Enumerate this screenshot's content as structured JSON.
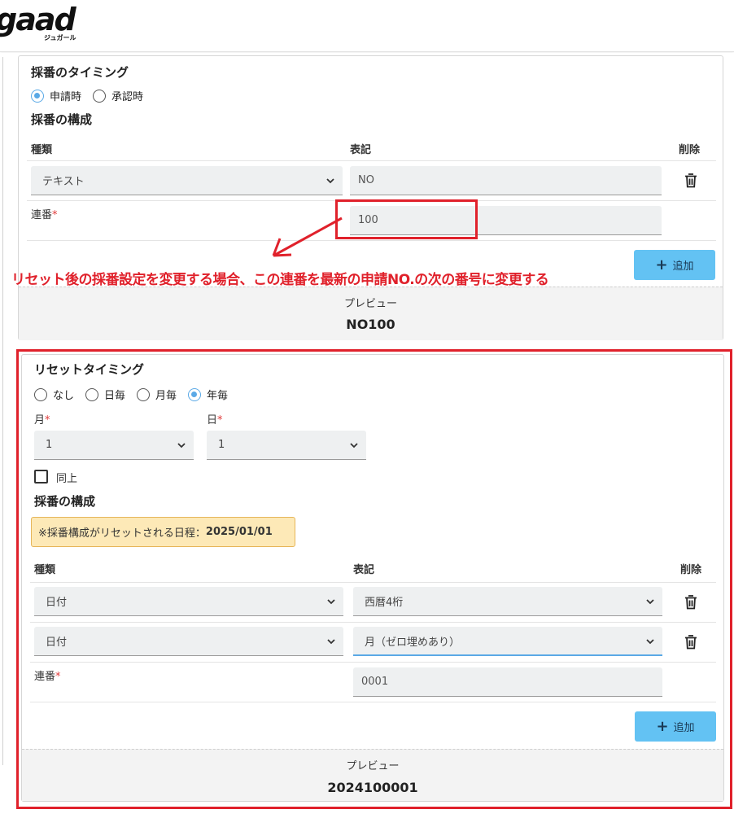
{
  "header": {
    "logo": "gaad",
    "logo_sub": "ジュガール"
  },
  "card1": {
    "timing_title": "採番のタイミング",
    "timing_options": [
      {
        "label": "申請時",
        "checked": true
      },
      {
        "label": "承認時",
        "checked": false
      }
    ],
    "composition_title": "採番の構成",
    "columns": {
      "type": "種類",
      "notation": "表記",
      "delete": "削除"
    },
    "row1": {
      "type_value": "テキスト",
      "notation_value": "NO"
    },
    "serial": {
      "label": "連番",
      "required": "*",
      "value": "100"
    },
    "add_button": {
      "label": "追加"
    },
    "preview": {
      "label": "プレビュー",
      "value": "NO100"
    }
  },
  "annotation": {
    "text": "リセット後の採番設定を変更する場合、この連番を最新の申請NO.の次の番号に変更する",
    "color": "#e0212b"
  },
  "card2": {
    "reset_title": "リセットタイミング",
    "reset_options": [
      {
        "label": "なし",
        "checked": false
      },
      {
        "label": "日毎",
        "checked": false
      },
      {
        "label": "月毎",
        "checked": false
      },
      {
        "label": "年毎",
        "checked": true
      }
    ],
    "month": {
      "label": "月",
      "required": "*",
      "value": "1"
    },
    "day": {
      "label": "日",
      "required": "*",
      "value": "1"
    },
    "same_as_above": {
      "label": "同上",
      "checked": false
    },
    "composition_title": "採番の構成",
    "notice": {
      "prefix": "※採番構成がリセットされる日程：",
      "date": "2025/01/01"
    },
    "columns": {
      "type": "種類",
      "notation": "表記",
      "delete": "削除"
    },
    "row1": {
      "type_value": "日付",
      "notation_value": "西暦4桁"
    },
    "row2": {
      "type_value": "日付",
      "notation_value": "月（ゼロ埋めあり）"
    },
    "serial": {
      "label": "連番",
      "required": "*",
      "value": "0001"
    },
    "add_button": {
      "label": "追加"
    },
    "preview": {
      "label": "プレビュー",
      "value": "2024100001"
    }
  },
  "colors": {
    "accent": "#5aa9e6",
    "button": "#63c2f3",
    "required": "#e03b3b",
    "notice_bg": "#fde9b7"
  }
}
